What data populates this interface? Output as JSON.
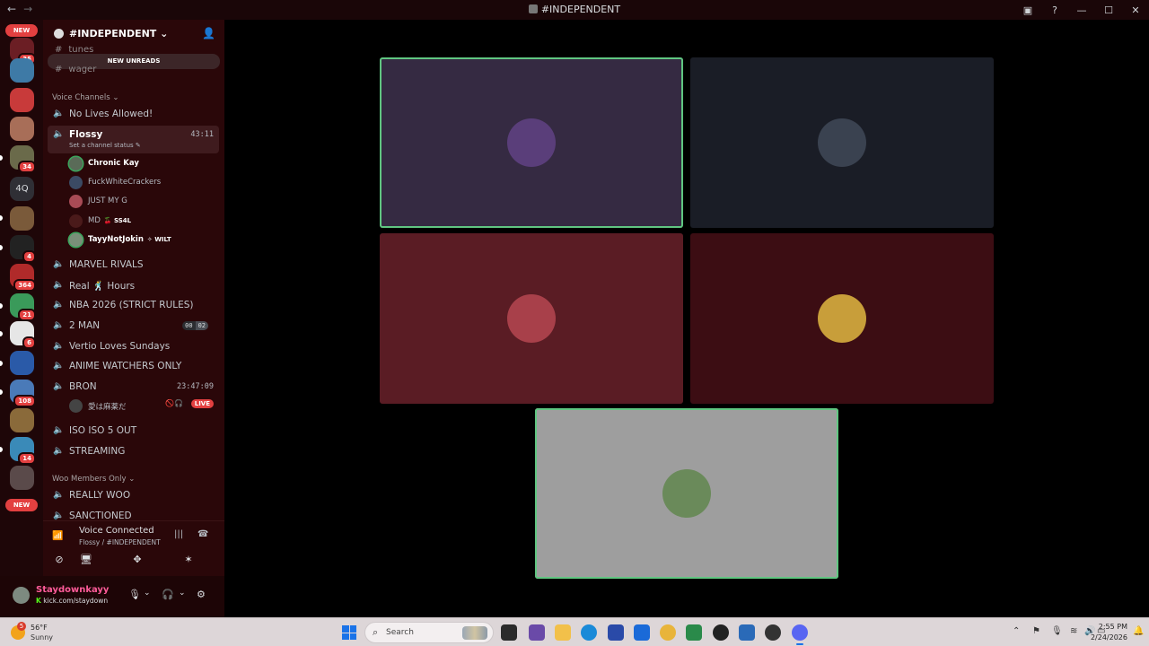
{
  "window": {
    "title": "#INDEPENDENT",
    "back_icon": "arrow-left-icon",
    "forward_icon": "arrow-right-icon"
  },
  "rail": {
    "new_top": "NEW",
    "new_bottom": "NEW",
    "badges": [
      "35",
      "34",
      "4",
      "364",
      "21",
      "6",
      "108",
      "14"
    ],
    "text_server": "4Q"
  },
  "server": {
    "name": "#INDEPENDENT",
    "new_unreads": "NEW UNREADS",
    "text_channels": [
      "tunes",
      "wager"
    ],
    "voice_category": "Voice Channels",
    "members_category": "Woo Members Only"
  },
  "voice_channels": [
    {
      "name": "No Lives Allowed!"
    },
    {
      "name": "Flossy",
      "timer": "43:11",
      "status": "Set a channel status",
      "active": true
    },
    {
      "name": "MARVEL RIVALS"
    },
    {
      "name": "Real 🕺 Hours"
    },
    {
      "name": "NBA 2026 (STRICT RULES)"
    },
    {
      "name": "2 MAN",
      "occupancy": [
        "00",
        "02"
      ]
    },
    {
      "name": "Vertio Loves Sundays"
    },
    {
      "name": "ANIME WATCHERS ONLY"
    },
    {
      "name": "BRON",
      "timer": "23:47:09"
    },
    {
      "name": "ISO ISO 5 OUT"
    },
    {
      "name": "STREAMING"
    }
  ],
  "members_channels": [
    "REALLY WOO",
    "SANCTIONED"
  ],
  "flossy_users": [
    {
      "name": "Chronic Kay",
      "speaking": true,
      "color": "#5a6b58"
    },
    {
      "name": "FuckWhiteCrackers",
      "speaking": false,
      "color": "#3b4a63"
    },
    {
      "name": "JUST MY G",
      "speaking": false,
      "color": "#a84b55"
    },
    {
      "name": "MD",
      "tag": "🍒 SS4L",
      "speaking": false,
      "color": "#4a1a1a"
    },
    {
      "name": "TayyNotJokin",
      "tag": "✧ WILT",
      "speaking": true,
      "color": "#7a8f79"
    }
  ],
  "bron_user": {
    "name": "愛は麻薬だ",
    "live": "LIVE",
    "color": "#444"
  },
  "voice_panel": {
    "status": "Voice Connected",
    "location": "Flossy / #INDEPENDENT"
  },
  "user_panel": {
    "username": "Staydownkayy",
    "status": "kick.com/staydown"
  },
  "stage": {
    "tiles": [
      {
        "bg": "#352a42",
        "avatar": "#5a3e7a",
        "speaking": true
      },
      {
        "bg": "#1a1d26",
        "avatar": "#3a4250",
        "speaking": false
      },
      {
        "bg": "#5a1c24",
        "avatar": "#a8404a",
        "speaking": false
      },
      {
        "bg": "#3c0d13",
        "avatar": "#c89e3a",
        "speaking": false
      },
      {
        "bg": "#9e9e9e",
        "avatar": "#6a8a5a",
        "speaking": true
      }
    ]
  },
  "taskbar": {
    "temp": "56°F",
    "condition": "Sunny",
    "weather_badge": "5",
    "search_placeholder": "Search",
    "time": "2:55 PM",
    "date": "2/24/2026"
  },
  "colors": {
    "accent_green": "#60c681",
    "badge_red": "#e34040",
    "sidebar_bg": "#2a0709"
  }
}
